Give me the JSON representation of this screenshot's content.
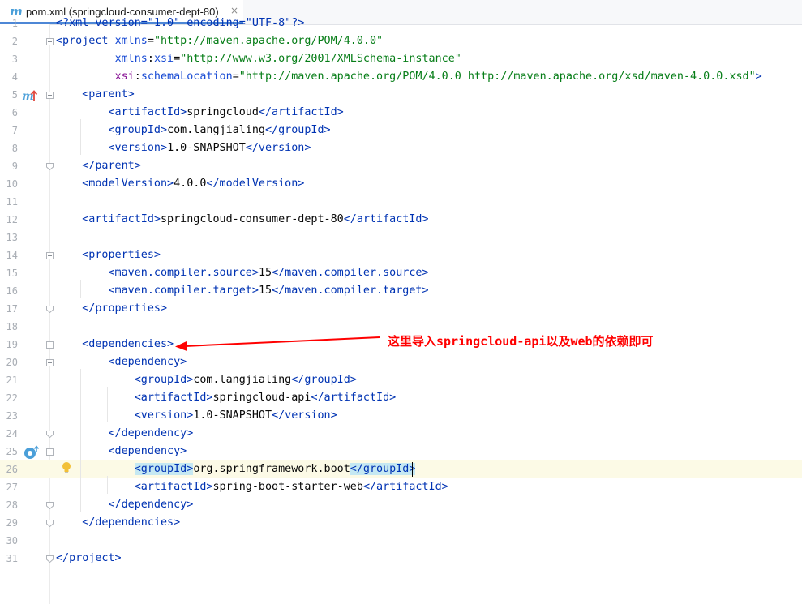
{
  "tab": {
    "icon_letter": "m",
    "title": "pom.xml (springcloud-consumer-dept-80)",
    "close_glyph": "×"
  },
  "lines": [
    {
      "n": "1",
      "html": "<span class='tag'>&lt;?xml version=&quot;1.0&quot; encoding=&quot;UTF-8&quot;?&gt;</span>"
    },
    {
      "n": "2",
      "html": "<span class='tag'>&lt;project</span> <span class='attr'>xmlns</span>=<span class='str'>\"http://maven.apache.org/POM/4.0.0\"</span>"
    },
    {
      "n": "3",
      "html": "         <span class='attr'>xmlns</span>:<span class='attr'>xsi</span>=<span class='str'>\"http://www.w3.org/2001/XMLSchema-instance\"</span>"
    },
    {
      "n": "4",
      "html": "         <span class='ns'>xsi</span>:<span class='attr'>schemaLocation</span>=<span class='str'>\"http://maven.apache.org/POM/4.0.0 http://maven.apache.org/xsd/maven-4.0.0.xsd\"</span><span class='tag'>&gt;</span>"
    },
    {
      "n": "5",
      "html": "    <span class='tag'>&lt;parent&gt;</span>"
    },
    {
      "n": "6",
      "html": "        <span class='tag'>&lt;artifactId&gt;</span>springcloud<span class='tag'>&lt;/artifactId&gt;</span>"
    },
    {
      "n": "7",
      "html": "        <span class='tag'>&lt;groupId&gt;</span>com.langjialing<span class='tag'>&lt;/groupId&gt;</span>"
    },
    {
      "n": "8",
      "html": "        <span class='tag'>&lt;version&gt;</span>1.0-SNAPSHOT<span class='tag'>&lt;/version&gt;</span>"
    },
    {
      "n": "9",
      "html": "    <span class='tag'>&lt;/parent&gt;</span>"
    },
    {
      "n": "10",
      "html": "    <span class='tag'>&lt;modelVersion&gt;</span>4.0.0<span class='tag'>&lt;/modelVersion&gt;</span>"
    },
    {
      "n": "11",
      "html": ""
    },
    {
      "n": "12",
      "html": "    <span class='tag'>&lt;artifactId&gt;</span>springcloud-consumer-dept-80<span class='tag'>&lt;/artifactId&gt;</span>"
    },
    {
      "n": "13",
      "html": ""
    },
    {
      "n": "14",
      "html": "    <span class='tag'>&lt;properties&gt;</span>"
    },
    {
      "n": "15",
      "html": "        <span class='tag'>&lt;maven.compiler.source&gt;</span>15<span class='tag'>&lt;/maven.compiler.source&gt;</span>"
    },
    {
      "n": "16",
      "html": "        <span class='tag'>&lt;maven.compiler.target&gt;</span>15<span class='tag'>&lt;/maven.compiler.target&gt;</span>"
    },
    {
      "n": "17",
      "html": "    <span class='tag'>&lt;/properties&gt;</span>"
    },
    {
      "n": "18",
      "html": ""
    },
    {
      "n": "19",
      "html": "    <span class='tag'>&lt;dependencies&gt;</span>"
    },
    {
      "n": "20",
      "html": "        <span class='tag'>&lt;dependency&gt;</span>"
    },
    {
      "n": "21",
      "html": "            <span class='tag'>&lt;groupId&gt;</span>com.langjialing<span class='tag'>&lt;/groupId&gt;</span>"
    },
    {
      "n": "22",
      "html": "            <span class='tag'>&lt;artifactId&gt;</span>springcloud-api<span class='tag'>&lt;/artifactId&gt;</span>"
    },
    {
      "n": "23",
      "html": "            <span class='tag'>&lt;version&gt;</span>1.0-SNAPSHOT<span class='tag'>&lt;/version&gt;</span>"
    },
    {
      "n": "24",
      "html": "        <span class='tag'>&lt;/dependency&gt;</span>"
    },
    {
      "n": "25",
      "html": "        <span class='tag'>&lt;dependency&gt;</span>"
    },
    {
      "n": "26",
      "html": "            <span class='tag hl'>&lt;groupId&gt;</span>org.springframework.boot<span class='tag hl'>&lt;/groupId&gt;</span>"
    },
    {
      "n": "27",
      "html": "            <span class='tag'>&lt;artifactId&gt;</span>spring-boot-starter-web<span class='tag'>&lt;/artifactId&gt;</span>"
    },
    {
      "n": "28",
      "html": "        <span class='tag'>&lt;/dependency&gt;</span>"
    },
    {
      "n": "29",
      "html": "    <span class='tag'>&lt;/dependencies&gt;</span>"
    },
    {
      "n": "30",
      "html": ""
    },
    {
      "n": "31",
      "html": "<span class='tag'>&lt;/project&gt;</span>"
    }
  ],
  "current_line": "26",
  "annotation": {
    "text": "这里导入springcloud-api以及web的依赖即可",
    "color": "#ff0000"
  },
  "icons": {
    "maven_parent": "maven-override-arrow-icon",
    "dependency_overrides": "overridden-method-icon",
    "intention": "lightbulb-icon"
  }
}
